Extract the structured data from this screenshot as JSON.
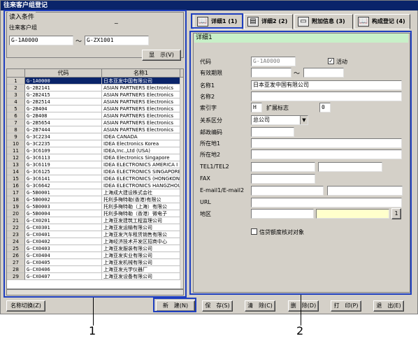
{
  "window": {
    "title": "往来客户组登记"
  },
  "conditions": {
    "legend": "读入条件",
    "group_label": "往来客户组",
    "tilde_top": "~",
    "from_value": "G-1A0000",
    "range_sep": "～",
    "to_value": "G-ZX1001",
    "show_button": "显　示(V)"
  },
  "grid": {
    "headers": [
      "",
      "代码",
      "名称1"
    ],
    "rows": [
      {
        "num": "1",
        "code": "G-1A0000",
        "name": "日本亚发中国有限公司"
      },
      {
        "num": "2",
        "code": "G-2B2141",
        "name": "ASIAN PARTNERS Electronics"
      },
      {
        "num": "3",
        "code": "G-2B2415",
        "name": "ASIAN PARTNERS Electronics"
      },
      {
        "num": "4",
        "code": "G-2B2514",
        "name": "ASIAN PARTNERS Electronics"
      },
      {
        "num": "5",
        "code": "G-2B404",
        "name": "ASIAN PARTNERS Electronics"
      },
      {
        "num": "6",
        "code": "G-2B408",
        "name": "ASIAN PARTNERS Electronics"
      },
      {
        "num": "7",
        "code": "G-2B5654",
        "name": "ASIAN PARTNERS Electronics"
      },
      {
        "num": "8",
        "code": "G-2B7444",
        "name": "ASIAN PARTNERS Electronics"
      },
      {
        "num": "9",
        "code": "G-3C2234",
        "name": "IDEA CANADA"
      },
      {
        "num": "10",
        "code": "G-3C2235",
        "name": "IDEA Electronics Korea"
      },
      {
        "num": "11",
        "code": "G-3C6109",
        "name": "IDEA,Inc.,Ltd (USA)"
      },
      {
        "num": "12",
        "code": "G-3C6113",
        "name": "IDEA Electronics Singapore"
      },
      {
        "num": "13",
        "code": "G-3C6119",
        "name": "IDEA ELECTRONICS AMERICA I"
      },
      {
        "num": "14",
        "code": "G-3C6125",
        "name": "IDEA ELECTRONICS SINGAPORE"
      },
      {
        "num": "15",
        "code": "G-3C6141",
        "name": "IDEA ELECTRONICS (HONGKONG"
      },
      {
        "num": "16",
        "code": "G-3C6642",
        "name": "IDEA ELECTRONICS HANGZHOU"
      },
      {
        "num": "17",
        "code": "G-5B0001",
        "name": "上海成大建设株式会社"
      },
      {
        "num": "18",
        "code": "G-5B0002",
        "name": "托利多梅特勒(香港)有限公"
      },
      {
        "num": "19",
        "code": "G-5B0003",
        "name": "托利多梅特勒（上海）有限公"
      },
      {
        "num": "20",
        "code": "G-5B0004",
        "name": "托利多梅特勒（香港）微电子"
      },
      {
        "num": "21",
        "code": "G-CX0201",
        "name": "上海亚发建筑工程监理公司"
      },
      {
        "num": "22",
        "code": "G-CX0301",
        "name": "上海亚发运输有限公司"
      },
      {
        "num": "23",
        "code": "G-CX0401",
        "name": "上海亚发汽车租赁销售有限公"
      },
      {
        "num": "24",
        "code": "G-CX0402",
        "name": "上海经济技术开发区招商中心"
      },
      {
        "num": "25",
        "code": "G-CX0403",
        "name": "上海亚发服装有限公司"
      },
      {
        "num": "26",
        "code": "G-CX0404",
        "name": "上海亚发实业有限公司"
      },
      {
        "num": "27",
        "code": "G-CX0405",
        "name": "上海亚发机械有限公司"
      },
      {
        "num": "28",
        "code": "G-CX0406",
        "name": "上海亚发光学仪器厂"
      },
      {
        "num": "29",
        "code": "G-CX0407",
        "name": "上海亚发设备有限公司"
      }
    ]
  },
  "tabs": [
    {
      "label": "详细1 (1)",
      "icon": "book-icon",
      "glyph": "📖"
    },
    {
      "label": "详细2 (2)",
      "icon": "ledger-icon",
      "glyph": "▤"
    },
    {
      "label": "附加信息 (3)",
      "icon": "monitor-icon",
      "glyph": "▭"
    },
    {
      "label": "构成登记 (4)",
      "icon": "book-icon",
      "glyph": "📖"
    }
  ],
  "detail": {
    "title": "详细1",
    "code_label": "代码",
    "code_value": "G-1A0000",
    "active_label": "活动",
    "active_checked": true,
    "valid_label": "有效期限",
    "valid_sep": "～",
    "name1_label": "名称1",
    "name1_value": "日本亚发中国有限公司",
    "name2_label": "名称2",
    "index_label": "索引字",
    "index_value": "H",
    "ext_label": "扩展标志",
    "ext_value": "0",
    "rel_label": "关系区分",
    "rel_value": "总公司",
    "zip_label": "邮政编码",
    "addr1_label": "所在地1",
    "addr2_label": "所在地2",
    "tel_label": "TEL1/TEL2",
    "fax_label": "FAX",
    "email_label": "E-mail1/E-mail2",
    "url_label": "URL",
    "area_label": "地区",
    "area_button": "1",
    "credit_label": "信贷额度核对对象"
  },
  "bottom": {
    "name_switch": "名称切换(Z)",
    "new": "新　建(N)",
    "save": "保　存(S)",
    "clear": "清　除(C)",
    "delete": "删　除(D)",
    "print": "打　印(P)",
    "exit": "退　出(E)"
  },
  "callouts": {
    "one": "1",
    "two": "2"
  },
  "colors": {
    "frame": "#1f3fbf",
    "titlebar": "#0a246a",
    "detail_title_bg": "#c8f0c8"
  }
}
